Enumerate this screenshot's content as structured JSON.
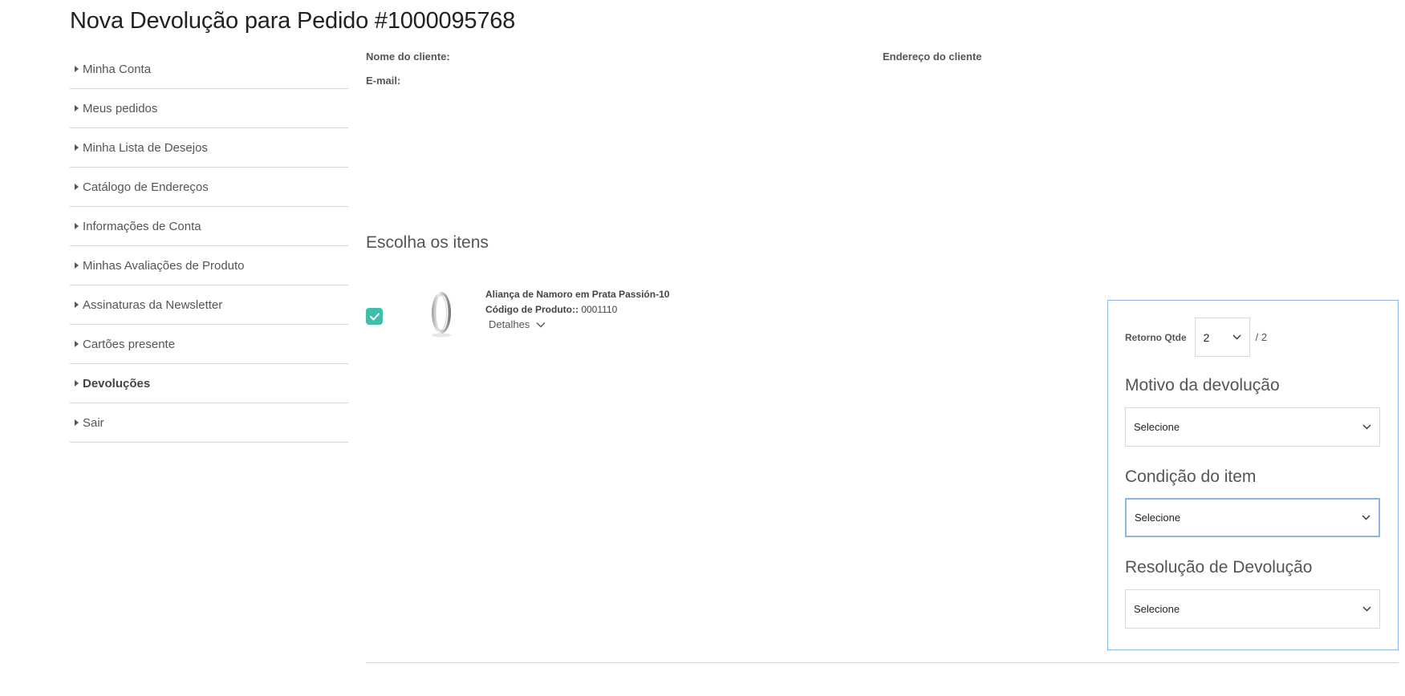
{
  "page": {
    "title": "Nova Devolução para Pedido #1000095768"
  },
  "sidebar": {
    "items": [
      {
        "label": "Minha Conta"
      },
      {
        "label": "Meus pedidos"
      },
      {
        "label": "Minha Lista de Desejos"
      },
      {
        "label": "Catálogo de Endereços"
      },
      {
        "label": "Informações de Conta"
      },
      {
        "label": "Minhas Avaliações de Produto"
      },
      {
        "label": "Assinaturas da Newsletter"
      },
      {
        "label": "Cartões presente"
      },
      {
        "label": "Devoluções"
      },
      {
        "label": "Sair"
      }
    ]
  },
  "customer": {
    "name_label": "Nome do cliente:",
    "email_label": "E-mail:",
    "address_label": "Endereço do cliente"
  },
  "items_section": {
    "title": "Escolha os itens"
  },
  "item": {
    "name": "Aliança de Namoro em Prata Passión-10",
    "sku_label": "Código de Produto::",
    "sku_value": "0001110",
    "details_label": "Detalhes",
    "checked": true
  },
  "return_panel": {
    "qty_label": "Retorno Qtde",
    "qty_value": "2",
    "qty_total": "/ 2",
    "reason_heading": "Motivo da devolução",
    "reason_value": "Selecione",
    "condition_heading": "Condição do item",
    "condition_value": "Selecione",
    "resolution_heading": "Resolução de Devolução",
    "resolution_value": "Selecione"
  },
  "colors": {
    "check": "#3fbfa8",
    "focus_border": "#8db5ec"
  }
}
